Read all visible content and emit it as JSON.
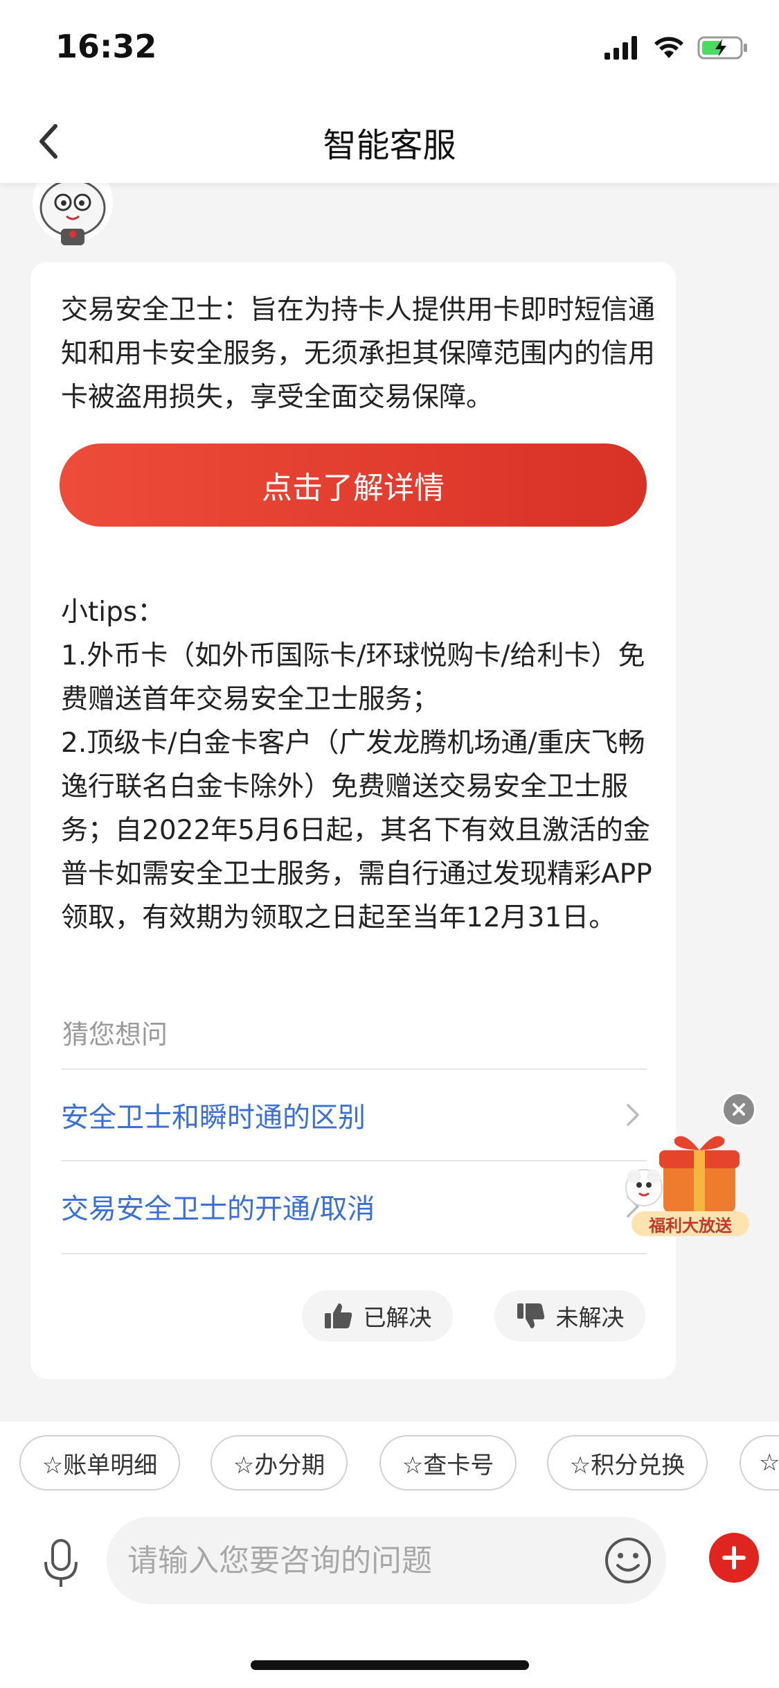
{
  "status_bar": {
    "time": "16:32"
  },
  "header": {
    "title": "智能客服"
  },
  "message": {
    "intro": "交易安全卫士：旨在为持卡人提供用卡即时短信通知和用卡安全服务，无须承担其保障范围内的信用卡被盗用损失，享受全面交易保障。",
    "detail_button": "点击了解详情",
    "tips": [
      "小tips：",
      "1.外币卡（如外币国际卡/环球悦购卡/给利卡）免费赠送首年交易安全卫士服务；",
      "2.顶级卡/白金卡客户（广发龙腾机场通/重庆飞畅逸行联名白金卡除外）免费赠送交易安全卫士服务；自2022年5月6日起，其名下有效且激活的金普卡如需安全卫士服务，需自行通过发现精彩APP领取，有效期为领取之日起至当年12月31日。"
    ],
    "guess_title": "猜您想问",
    "questions": [
      "安全卫士和瞬时通的区别",
      "交易安全卫士的开通/取消"
    ],
    "feedback": {
      "resolved": "已解决",
      "unresolved": "未解决"
    }
  },
  "floating_promo": {
    "label": "福利大放送"
  },
  "quick_replies": [
    "☆账单明细",
    "☆办分期",
    "☆查卡号",
    "☆积分兑换",
    "☆"
  ],
  "input": {
    "placeholder": "请输入您要咨询的问题"
  },
  "colors": {
    "accent_red": "#e0241f",
    "link_blue": "#3a6fd8",
    "button_gradient_start": "#ee4c3a",
    "button_gradient_end": "#d83126"
  }
}
